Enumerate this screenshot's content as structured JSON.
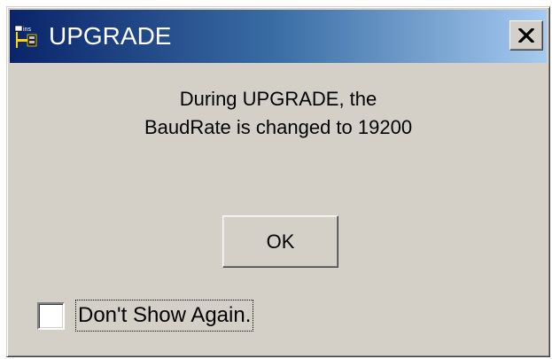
{
  "window": {
    "title": "UPGRADE",
    "icon": "ins-connector-icon",
    "close_glyph": "✕"
  },
  "message": {
    "line1": "During UPGRADE, the",
    "line2": "BaudRate is changed to 19200"
  },
  "buttons": {
    "ok_label": "OK"
  },
  "checkbox": {
    "label": "Don't Show Again.",
    "checked": false
  },
  "colors": {
    "title_gradient_start": "#0a246a",
    "title_gradient_end": "#a6caf0",
    "face": "#d4d0c8"
  }
}
